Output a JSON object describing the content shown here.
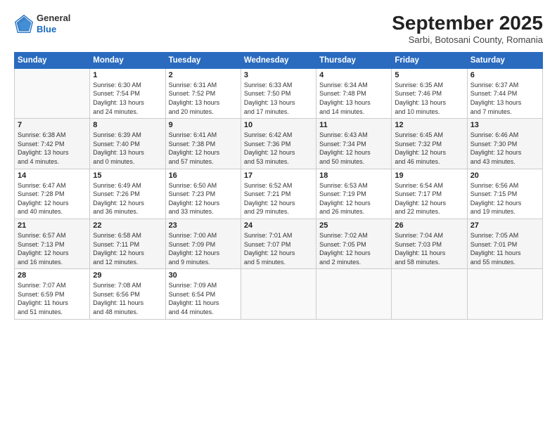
{
  "logo": {
    "general": "General",
    "blue": "Blue"
  },
  "header": {
    "month": "September 2025",
    "location": "Sarbi, Botosani County, Romania"
  },
  "weekdays": [
    "Sunday",
    "Monday",
    "Tuesday",
    "Wednesday",
    "Thursday",
    "Friday",
    "Saturday"
  ],
  "weeks": [
    [
      {
        "day": "",
        "info": ""
      },
      {
        "day": "1",
        "info": "Sunrise: 6:30 AM\nSunset: 7:54 PM\nDaylight: 13 hours\nand 24 minutes."
      },
      {
        "day": "2",
        "info": "Sunrise: 6:31 AM\nSunset: 7:52 PM\nDaylight: 13 hours\nand 20 minutes."
      },
      {
        "day": "3",
        "info": "Sunrise: 6:33 AM\nSunset: 7:50 PM\nDaylight: 13 hours\nand 17 minutes."
      },
      {
        "day": "4",
        "info": "Sunrise: 6:34 AM\nSunset: 7:48 PM\nDaylight: 13 hours\nand 14 minutes."
      },
      {
        "day": "5",
        "info": "Sunrise: 6:35 AM\nSunset: 7:46 PM\nDaylight: 13 hours\nand 10 minutes."
      },
      {
        "day": "6",
        "info": "Sunrise: 6:37 AM\nSunset: 7:44 PM\nDaylight: 13 hours\nand 7 minutes."
      }
    ],
    [
      {
        "day": "7",
        "info": "Sunrise: 6:38 AM\nSunset: 7:42 PM\nDaylight: 13 hours\nand 4 minutes."
      },
      {
        "day": "8",
        "info": "Sunrise: 6:39 AM\nSunset: 7:40 PM\nDaylight: 13 hours\nand 0 minutes."
      },
      {
        "day": "9",
        "info": "Sunrise: 6:41 AM\nSunset: 7:38 PM\nDaylight: 12 hours\nand 57 minutes."
      },
      {
        "day": "10",
        "info": "Sunrise: 6:42 AM\nSunset: 7:36 PM\nDaylight: 12 hours\nand 53 minutes."
      },
      {
        "day": "11",
        "info": "Sunrise: 6:43 AM\nSunset: 7:34 PM\nDaylight: 12 hours\nand 50 minutes."
      },
      {
        "day": "12",
        "info": "Sunrise: 6:45 AM\nSunset: 7:32 PM\nDaylight: 12 hours\nand 46 minutes."
      },
      {
        "day": "13",
        "info": "Sunrise: 6:46 AM\nSunset: 7:30 PM\nDaylight: 12 hours\nand 43 minutes."
      }
    ],
    [
      {
        "day": "14",
        "info": "Sunrise: 6:47 AM\nSunset: 7:28 PM\nDaylight: 12 hours\nand 40 minutes."
      },
      {
        "day": "15",
        "info": "Sunrise: 6:49 AM\nSunset: 7:26 PM\nDaylight: 12 hours\nand 36 minutes."
      },
      {
        "day": "16",
        "info": "Sunrise: 6:50 AM\nSunset: 7:23 PM\nDaylight: 12 hours\nand 33 minutes."
      },
      {
        "day": "17",
        "info": "Sunrise: 6:52 AM\nSunset: 7:21 PM\nDaylight: 12 hours\nand 29 minutes."
      },
      {
        "day": "18",
        "info": "Sunrise: 6:53 AM\nSunset: 7:19 PM\nDaylight: 12 hours\nand 26 minutes."
      },
      {
        "day": "19",
        "info": "Sunrise: 6:54 AM\nSunset: 7:17 PM\nDaylight: 12 hours\nand 22 minutes."
      },
      {
        "day": "20",
        "info": "Sunrise: 6:56 AM\nSunset: 7:15 PM\nDaylight: 12 hours\nand 19 minutes."
      }
    ],
    [
      {
        "day": "21",
        "info": "Sunrise: 6:57 AM\nSunset: 7:13 PM\nDaylight: 12 hours\nand 16 minutes."
      },
      {
        "day": "22",
        "info": "Sunrise: 6:58 AM\nSunset: 7:11 PM\nDaylight: 12 hours\nand 12 minutes."
      },
      {
        "day": "23",
        "info": "Sunrise: 7:00 AM\nSunset: 7:09 PM\nDaylight: 12 hours\nand 9 minutes."
      },
      {
        "day": "24",
        "info": "Sunrise: 7:01 AM\nSunset: 7:07 PM\nDaylight: 12 hours\nand 5 minutes."
      },
      {
        "day": "25",
        "info": "Sunrise: 7:02 AM\nSunset: 7:05 PM\nDaylight: 12 hours\nand 2 minutes."
      },
      {
        "day": "26",
        "info": "Sunrise: 7:04 AM\nSunset: 7:03 PM\nDaylight: 11 hours\nand 58 minutes."
      },
      {
        "day": "27",
        "info": "Sunrise: 7:05 AM\nSunset: 7:01 PM\nDaylight: 11 hours\nand 55 minutes."
      }
    ],
    [
      {
        "day": "28",
        "info": "Sunrise: 7:07 AM\nSunset: 6:59 PM\nDaylight: 11 hours\nand 51 minutes."
      },
      {
        "day": "29",
        "info": "Sunrise: 7:08 AM\nSunset: 6:56 PM\nDaylight: 11 hours\nand 48 minutes."
      },
      {
        "day": "30",
        "info": "Sunrise: 7:09 AM\nSunset: 6:54 PM\nDaylight: 11 hours\nand 44 minutes."
      },
      {
        "day": "",
        "info": ""
      },
      {
        "day": "",
        "info": ""
      },
      {
        "day": "",
        "info": ""
      },
      {
        "day": "",
        "info": ""
      }
    ]
  ]
}
